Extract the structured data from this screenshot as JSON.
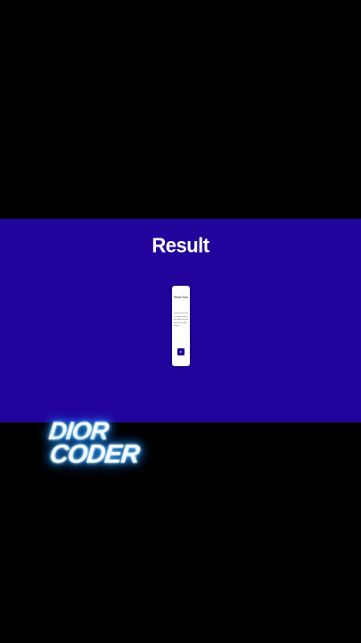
{
  "colors": {
    "background": "#000000",
    "band": "#22049c",
    "card": "#ffffff",
    "accent": "#22049c",
    "glow": "#2d9dff"
  },
  "result": {
    "title": "Result"
  },
  "card": {
    "title": "Read Sun",
    "text": "Lorem ipsum dolor sit amet consectetur adipiscing elit sed do eiusmod tempor",
    "button_icon": "play-arrow-icon"
  },
  "logo": {
    "line1": "DIOR",
    "line2": "CODER"
  }
}
